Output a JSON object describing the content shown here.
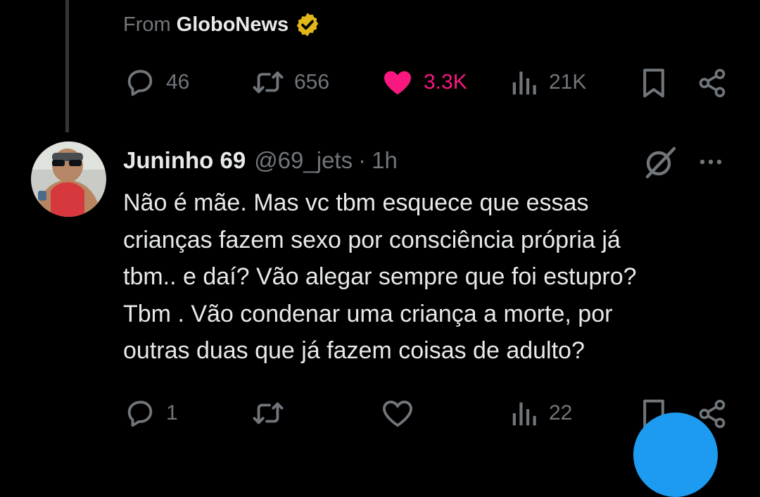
{
  "parent_tweet": {
    "from_label": "From",
    "from_source": "GloboNews",
    "stats": {
      "replies": "46",
      "retweets": "656",
      "likes": "3.3K",
      "views": "21K"
    },
    "liked": true
  },
  "reply_tweet": {
    "display_name": "Juninho 69",
    "handle": "@69_jets",
    "separator": "·",
    "time": "1h",
    "text": "Não é mãe.  Mas vc tbm esquece que essas\ncrianças fazem sexo por consciência própria já\ntbm.. e daí? Vão alegar sempre que foi estupro?\nTbm . Vão condenar uma criança a morte, por\noutras duas que já fazem coisas de adulto?",
    "stats": {
      "replies": "1",
      "retweets": "",
      "likes": "",
      "views": "22"
    }
  },
  "icons": {
    "reply": "reply-icon",
    "retweet": "retweet-icon",
    "like": "heart-icon",
    "views": "views-icon",
    "bookmark": "bookmark-icon",
    "share": "share-icon",
    "grok": "grok-icon",
    "more": "more-icon",
    "verified": "verified-badge-icon"
  },
  "colors": {
    "background": "#000000",
    "text": "#e7e9ea",
    "muted": "#71767b",
    "like": "#f91880",
    "verified_gold": "#e2b719",
    "accent": "#1d9bf0"
  }
}
